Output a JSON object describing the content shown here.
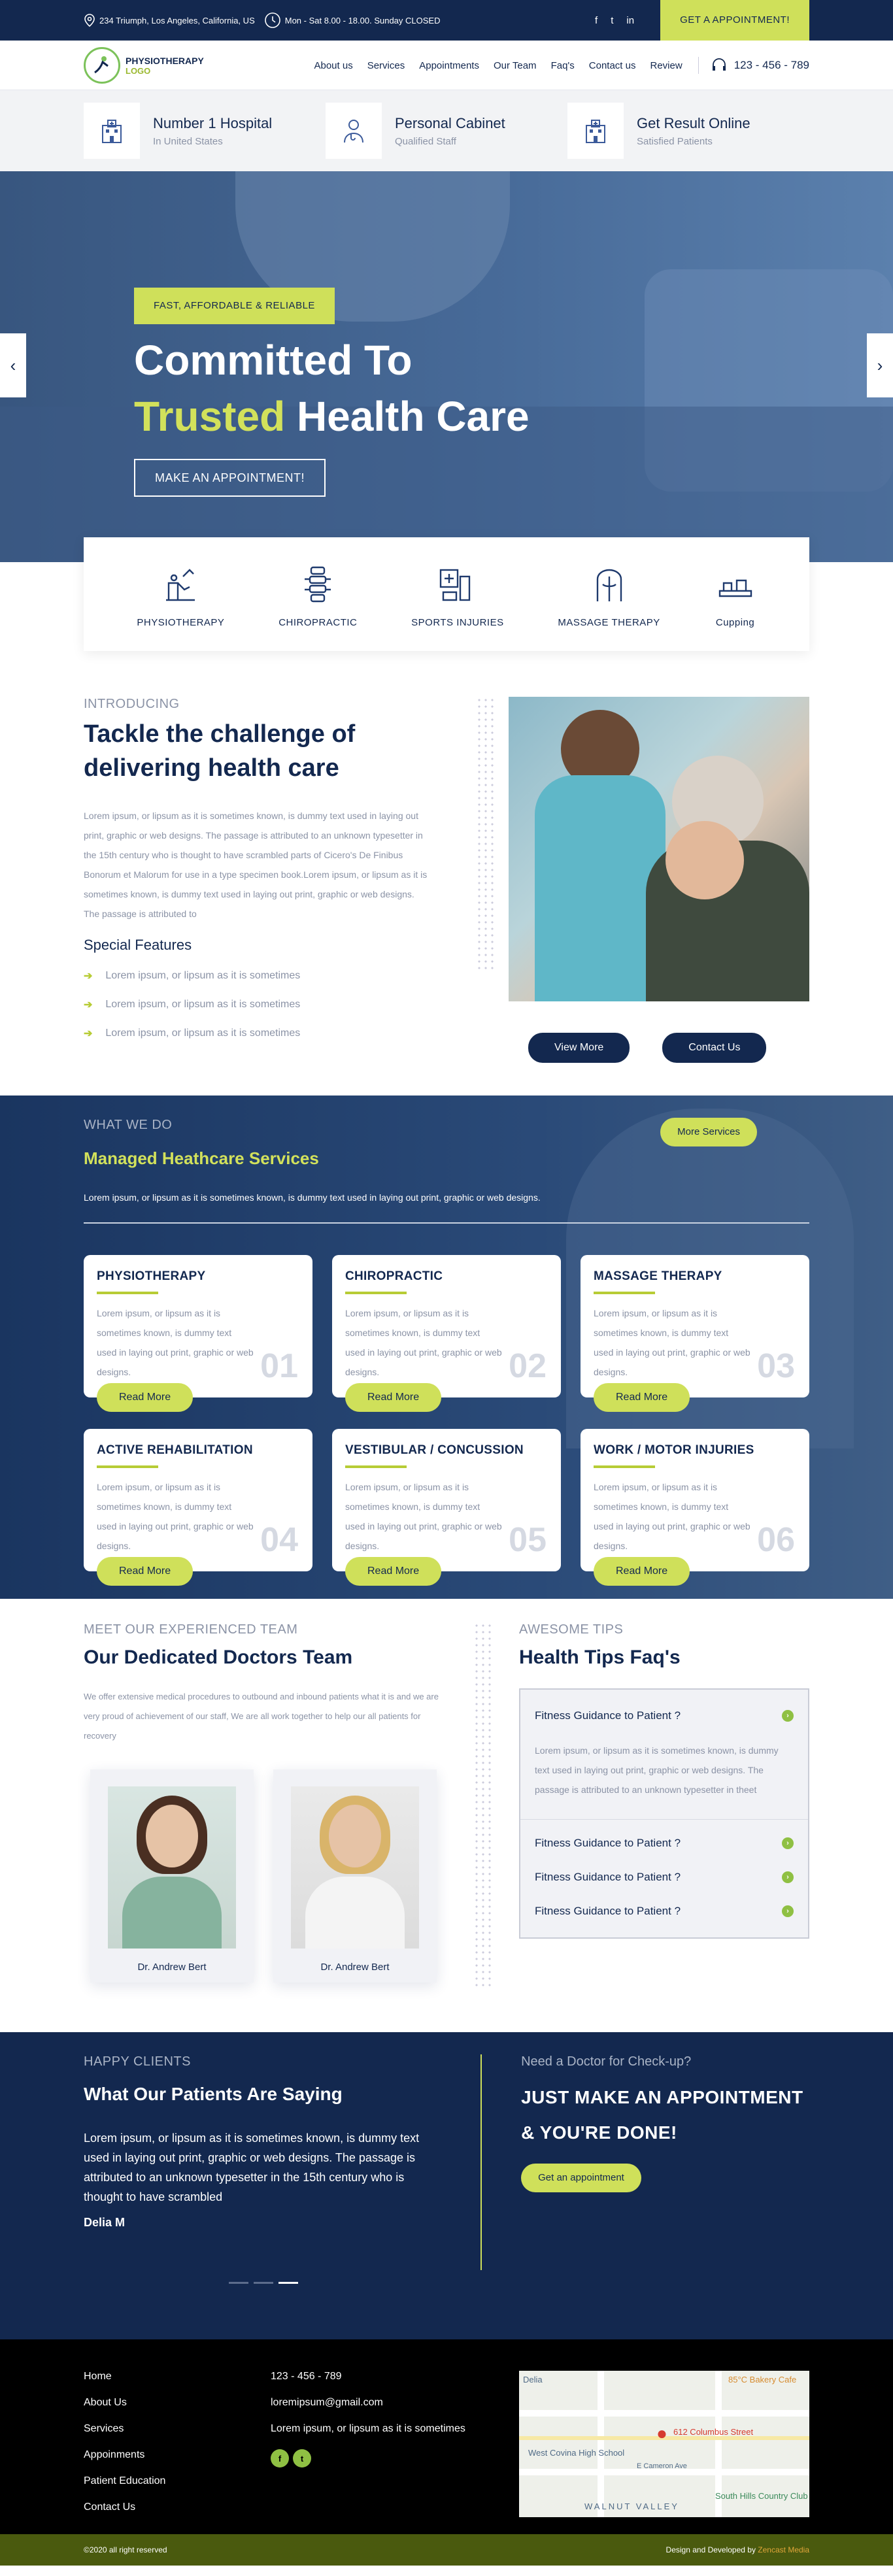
{
  "topbar": {
    "address": "234 Triumph, Los Angeles, California, US",
    "hours": "Mon - Sat 8.00 - 18.00. Sunday CLOSED",
    "social": [
      "f",
      "t",
      "in"
    ],
    "appointment_label": "GET A APPOINTMENT!"
  },
  "header": {
    "logo_title": "PHYSIOTHERAPY",
    "logo_sub": "LOGO",
    "nav": [
      "About us",
      "Services",
      "Appointments",
      "Our Team",
      "Faq's",
      "Contact us",
      "Review"
    ],
    "phone": "123 - 456 - 789"
  },
  "features": [
    {
      "title": "Number 1 Hospital",
      "sub": "In United States",
      "icon": "hospital-icon"
    },
    {
      "title": "Personal Cabinet",
      "sub": "Qualified Staff",
      "icon": "doctor-icon"
    },
    {
      "title": "Get Result Online",
      "sub": "Satisfied Patients",
      "icon": "hospital-icon"
    }
  ],
  "hero": {
    "tag": "FAST, AFFORDABLE & RELIABLE",
    "title_line1": "Committed To",
    "title_highlight": "Trusted",
    "title_rest": " Health Care",
    "button": "MAKE AN APPOINTMENT!"
  },
  "service_icons": [
    "PHYSIOTHERAPY",
    "CHIROPRACTIC",
    "SPORTS INJURIES",
    "MASSAGE THERAPY",
    "Cupping"
  ],
  "intro": {
    "eyebrow": "INTRODUCING",
    "title": "Tackle the challenge of delivering health care",
    "paragraph": "Lorem ipsum, or lipsum as it is sometimes known, is dummy text used in laying out print, graphic or web designs. The passage is attributed to an unknown typesetter in the 15th century who is thought to have scrambled parts of Cicero's De Finibus Bonorum et Malorum for use in a type specimen book.Lorem ipsum, or lipsum as it is sometimes known, is dummy text used in laying out print, graphic or web designs. The passage is attributed to",
    "features_title": "Special Features",
    "bullets": [
      "Lorem ipsum, or lipsum as it is sometimes",
      "Lorem ipsum, or lipsum as it is sometimes",
      "Lorem ipsum, or lipsum as it is sometimes"
    ],
    "btn_view": "View More",
    "btn_contact": "Contact Us"
  },
  "whatwedo": {
    "eyebrow": "WHAT WE DO",
    "title": "Managed Heathcare Services",
    "more": "More Services",
    "desc": "Lorem ipsum, or lipsum as it is sometimes known, is dummy text used in laying out print, graphic or web designs.",
    "card_desc": "Lorem ipsum, or lipsum as it is sometimes known, is dummy text used in laying out print, graphic or web designs.",
    "read_more": "Read More",
    "cards": [
      {
        "title": "PHYSIOTHERAPY",
        "num": "01"
      },
      {
        "title": "CHIROPRACTIC",
        "num": "02"
      },
      {
        "title": "MASSAGE THERAPY",
        "num": "03"
      },
      {
        "title": "ACTIVE REHABILITATION",
        "num": "04"
      },
      {
        "title": "VESTIBULAR / CONCUSSION",
        "num": "05"
      },
      {
        "title": "WORK / MOTOR INJURIES",
        "num": "06"
      }
    ]
  },
  "team": {
    "eyebrow": "MEET OUR EXPERIENCED TEAM",
    "title": "Our Dedicated Doctors Team",
    "para": "We offer extensive medical procedures to outbound and inbound patients what it is and we are very proud of achievement of our staff, We are all work together to help our all patients for recovery",
    "doctors": [
      "Dr. Andrew Bert",
      "Dr. Andrew Bert"
    ]
  },
  "faq": {
    "eyebrow": "AWESOME TIPS",
    "title": "Health Tips Faq's",
    "items": [
      "Fitness Guidance to Patient ?",
      "Fitness Guidance to Patient ?",
      "Fitness Guidance to Patient ?",
      "Fitness Guidance to Patient ?"
    ],
    "answer": "Lorem ipsum, or lipsum as it is sometimes known, is dummy text used in laying out print, graphic or web designs. The passage is attributed to an unknown typesetter in theet"
  },
  "testimonials": {
    "eyebrow": "HAPPY CLIENTS",
    "title": "What Our Patients Are Saying",
    "quote": "Lorem ipsum, or lipsum as it is sometimes known, is dummy text used in laying out print, graphic or web designs. The passage is attributed to an unknown typesetter in the 15th century who is thought to have scrambled",
    "name": "Delia M"
  },
  "checkup": {
    "question": "Need a Doctor for Check-up?",
    "headline": "JUST MAKE AN APPOINTMENT & YOU'RE DONE!",
    "button": "Get an appointment"
  },
  "footer": {
    "links": [
      "Home",
      "About Us",
      "Services",
      "Appoinments",
      "Patient Education",
      "Contact Us"
    ],
    "phone": "123 - 456 - 789",
    "email": "loremipsum@gmail.com",
    "text": "Lorem ipsum, or lipsum as it is sometimes",
    "social": [
      "f",
      "t"
    ],
    "map_labels": [
      "Delia",
      "85°C Bakery Cafe",
      "612 Columbus Street",
      "West Covina High School",
      "E Cameron Ave",
      "WALNUT VALLEY",
      "South Hills Country Club"
    ]
  },
  "copyright": {
    "left": "©2020 all right reserved",
    "right_prefix": "Design and Developed by ",
    "right_brand": "Zencast Media"
  }
}
